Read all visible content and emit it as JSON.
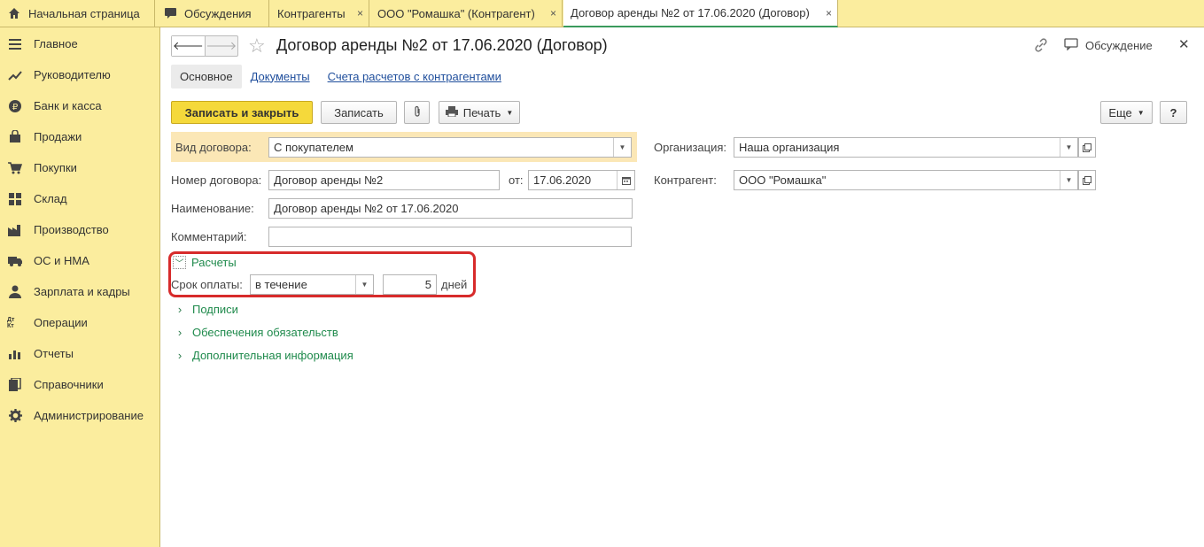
{
  "tabs": [
    {
      "label": "Начальная страница",
      "icon": "home-icon"
    },
    {
      "label": "Обсуждения",
      "icon": "chat-icon"
    },
    {
      "label": "Контрагенты",
      "close": "×"
    },
    {
      "label": "ООО \"Ромашка\" (Контрагент)",
      "close": "×"
    },
    {
      "label": "Договор аренды №2 от 17.06.2020 (Договор)",
      "close": "×"
    }
  ],
  "sidebar": {
    "items": [
      {
        "label": "Главное",
        "icon": "menu-icon"
      },
      {
        "label": "Руководителю",
        "icon": "trend-icon"
      },
      {
        "label": "Банк и касса",
        "icon": "ruble-icon"
      },
      {
        "label": "Продажи",
        "icon": "bag-icon"
      },
      {
        "label": "Покупки",
        "icon": "cart-icon"
      },
      {
        "label": "Склад",
        "icon": "grid-icon"
      },
      {
        "label": "Производство",
        "icon": "factory-icon"
      },
      {
        "label": "ОС и НМА",
        "icon": "truck-icon"
      },
      {
        "label": "Зарплата и кадры",
        "icon": "person-icon"
      },
      {
        "label": "Операции",
        "icon": "dt-kt-icon",
        "icon_text": "Дт Кт"
      },
      {
        "label": "Отчеты",
        "icon": "bar-chart-icon"
      },
      {
        "label": "Справочники",
        "icon": "book-icon"
      },
      {
        "label": "Администрирование",
        "icon": "gear-icon"
      }
    ]
  },
  "header": {
    "title": "Договор аренды №2 от 17.06.2020 (Договор)",
    "discuss_label": "Обсуждение"
  },
  "subtabs": {
    "active": "Основное",
    "links": [
      "Документы",
      "Счета расчетов с контрагентами"
    ]
  },
  "toolbar": {
    "save_close": "Записать и закрыть",
    "save": "Записать",
    "print": "Печать",
    "more": "Еще",
    "help": "?"
  },
  "form": {
    "contract_type_label": "Вид договора:",
    "contract_type_value": "С покупателем",
    "number_label": "Номер договора:",
    "number_value": "Договор аренды №2",
    "date_label": "от:",
    "date_value": "17.06.2020",
    "name_label": "Наименование:",
    "name_value": "Договор аренды №2 от 17.06.2020",
    "comment_label": "Комментарий:",
    "comment_value": "",
    "org_label": "Организация:",
    "org_value": "Наша организация",
    "counterparty_label": "Контрагент:",
    "counterparty_value": "ООО \"Ромашка\""
  },
  "settlements": {
    "group_label": "Расчеты",
    "term_label": "Срок оплаты:",
    "term_mode": "в течение",
    "term_days": "5",
    "days_unit": "дней"
  },
  "groups": [
    "Подписи",
    "Обеспечения обязательств",
    "Дополнительная информация"
  ],
  "colors": {
    "accent_yellow": "#f5d93b",
    "panel_yellow": "#fbed9e",
    "highlight": "#d72b2b",
    "group_green": "#1f8a4c",
    "link_blue": "#1f4e9c"
  }
}
